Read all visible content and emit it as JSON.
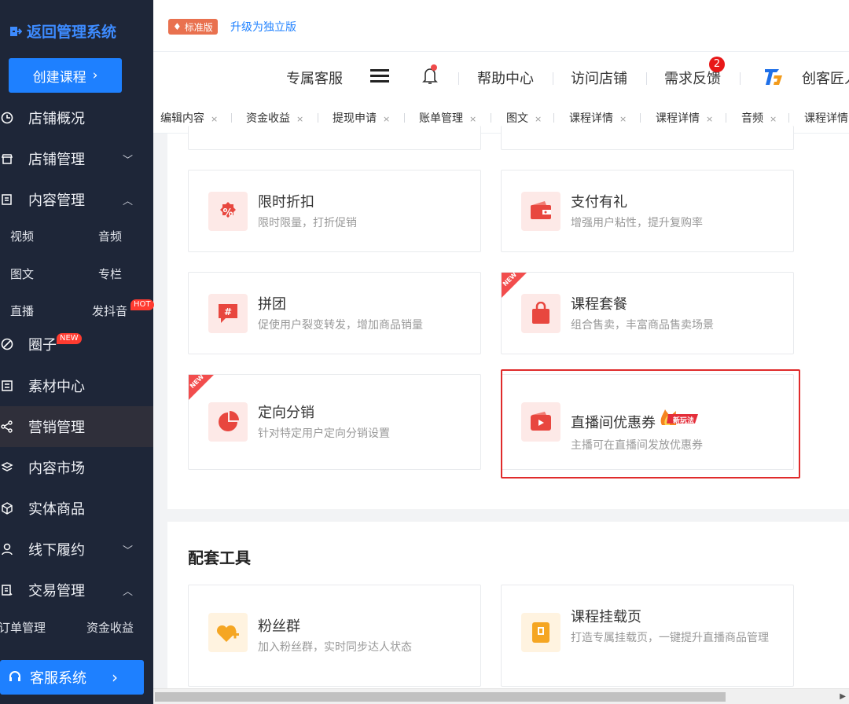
{
  "sidebar": {
    "back_label": "返回管理系统",
    "create_label": "创建课程",
    "nav": [
      {
        "label": "店铺概况",
        "icon": "clock-icon",
        "caret": ""
      },
      {
        "label": "店铺管理",
        "icon": "store-icon",
        "caret": "﹀"
      },
      {
        "label": "内容管理",
        "icon": "content-icon",
        "caret": "︿"
      },
      {
        "label": "圈子",
        "icon": "circle-icon",
        "caret": "",
        "badge": "NEW"
      },
      {
        "label": "素材中心",
        "icon": "material-icon",
        "caret": ""
      },
      {
        "label": "营销管理",
        "icon": "share-icon",
        "caret": ""
      },
      {
        "label": "内容市场",
        "icon": "layers-icon",
        "caret": ""
      },
      {
        "label": "实体商品",
        "icon": "cube-icon",
        "caret": ""
      },
      {
        "label": "线下履约",
        "icon": "user-icon",
        "caret": "﹀"
      },
      {
        "label": "交易管理",
        "icon": "trade-icon",
        "caret": "︿"
      }
    ],
    "content_sub": [
      "视频",
      "音频",
      "图文",
      "专栏",
      "直播",
      "发抖音"
    ],
    "hot_badge": "HOT",
    "trade_sub": [
      "订单管理",
      "资金收益"
    ],
    "service_label": "客服系统"
  },
  "topbar": {
    "version_label": "标准版",
    "upgrade_label": "升级为独立版"
  },
  "header": {
    "service": "专属客服",
    "help": "帮助中心",
    "visit_store": "访问店铺",
    "feedback": "需求反馈",
    "feedback_count": "2",
    "brand": "创客匠人"
  },
  "tabs": [
    "编辑内容",
    "资金收益",
    "提现申请",
    "账单管理",
    "图文",
    "课程详情",
    "课程详情",
    "音频",
    "课程详情"
  ],
  "tab_close": "×",
  "marketing_cards": [
    {
      "title": "限时折扣",
      "desc": "限时限量，打折促销",
      "icon": "discount-icon",
      "new": false
    },
    {
      "title": "支付有礼",
      "desc": "增强用户粘性，提升复购率",
      "icon": "wallet-icon",
      "new": false
    },
    {
      "title": "拼团",
      "desc": "促使用户裂变转发，增加商品销量",
      "icon": "group-buy-icon",
      "new": false
    },
    {
      "title": "课程套餐",
      "desc": "组合售卖，丰富商品售卖场景",
      "icon": "bag-icon",
      "new": true
    },
    {
      "title": "定向分销",
      "desc": "针对特定用户定向分销设置",
      "icon": "pie-icon",
      "new": true
    },
    {
      "title": "直播间优惠券",
      "desc": "主播可在直播间发放优惠券",
      "icon": "live-coupon-icon",
      "new": false,
      "tag": "新玩法"
    }
  ],
  "new_ribbon": "NEW",
  "tools_section": {
    "title": "配套工具",
    "cards": [
      {
        "title": "粉丝群",
        "desc": "加入粉丝群，实时同步达人状态",
        "icon": "fan-group-icon"
      },
      {
        "title": "课程挂载页",
        "desc": "打造专属挂载页，一键提升直播商品管理",
        "icon": "mount-page-icon"
      }
    ]
  },
  "colors": {
    "sidebar_bg": "#1e2638",
    "primary": "#1e80ff",
    "accent_red": "#e8473f",
    "tool_orange": "#f5a623"
  }
}
